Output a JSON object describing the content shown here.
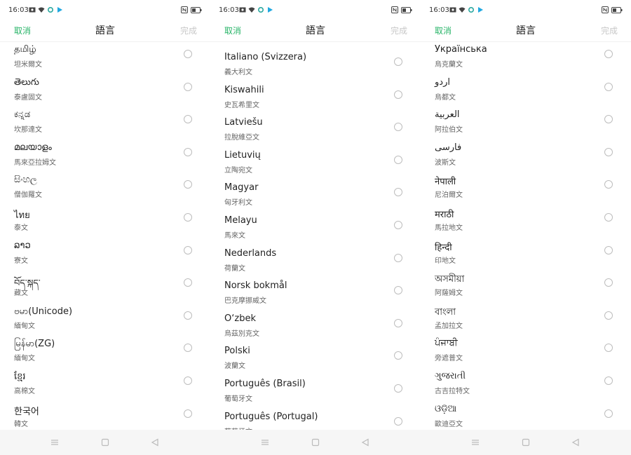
{
  "status_bar": {
    "time": "16:03"
  },
  "header": {
    "cancel_label": "取消",
    "title": "語言",
    "done_label": "完成"
  },
  "colors": {
    "accent": "#28b468",
    "done_disabled": "#c8c8c8"
  },
  "screens": [
    {
      "items": [
        {
          "native": "தமிழ்",
          "localized": "坦米爾文"
        },
        {
          "native": "తెలుగు",
          "localized": "泰盧固文"
        },
        {
          "native": "ಕನ್ನಡ",
          "localized": "坎那達文"
        },
        {
          "native": "മലയാളം",
          "localized": "馬來亞拉姆文"
        },
        {
          "native": "සිංහල",
          "localized": "僧伽羅文"
        },
        {
          "native": "ไทย",
          "localized": "泰文"
        },
        {
          "native": "ລາວ",
          "localized": "寮文"
        },
        {
          "native": "བོད་སྐད་",
          "localized": "藏文"
        },
        {
          "native": "ဗမာ(Unicode)",
          "localized": "緬甸文"
        },
        {
          "native": "မြန်မာ(ZG)",
          "localized": "緬甸文"
        },
        {
          "native": "ខ្មែរ",
          "localized": "高棉文"
        },
        {
          "native": "한국어",
          "localized": "韓文"
        }
      ]
    },
    {
      "items": [
        {
          "native": "Italiano (Svizzera)",
          "localized": "義大利文"
        },
        {
          "native": "Kiswahili",
          "localized": "史瓦希里文"
        },
        {
          "native": "Latviešu",
          "localized": "拉脫維亞文"
        },
        {
          "native": "Lietuvių",
          "localized": "立陶宛文"
        },
        {
          "native": "Magyar",
          "localized": "匈牙利文"
        },
        {
          "native": "Melayu",
          "localized": "馬來文"
        },
        {
          "native": "Nederlands",
          "localized": "荷蘭文"
        },
        {
          "native": "Norsk bokmål",
          "localized": "巴克摩挪威文"
        },
        {
          "native": "O‘zbek",
          "localized": "烏茲別克文"
        },
        {
          "native": "Polski",
          "localized": "波蘭文"
        },
        {
          "native": "Português (Brasil)",
          "localized": "葡萄牙文"
        },
        {
          "native": "Português (Portugal)",
          "localized": "葡萄牙文"
        }
      ]
    },
    {
      "items": [
        {
          "native": "Українська",
          "localized": "烏克蘭文"
        },
        {
          "native": "اردو",
          "localized": "烏都文"
        },
        {
          "native": "العربية",
          "localized": "阿拉伯文"
        },
        {
          "native": "فارسی",
          "localized": "波斯文"
        },
        {
          "native": "नेपाली",
          "localized": "尼泊爾文"
        },
        {
          "native": "मराठी",
          "localized": "馬拉地文"
        },
        {
          "native": "हिन्दी",
          "localized": "印地文"
        },
        {
          "native": "অসমীয়া",
          "localized": "阿薩姆文"
        },
        {
          "native": "বাংলা",
          "localized": "孟加拉文"
        },
        {
          "native": "ਪੰਜਾਬੀ",
          "localized": "旁遮普文"
        },
        {
          "native": "ગુજરાતી",
          "localized": "古吉拉特文"
        },
        {
          "native": "ଓଡ଼ିଆ",
          "localized": "歐迪亞文"
        }
      ]
    }
  ]
}
